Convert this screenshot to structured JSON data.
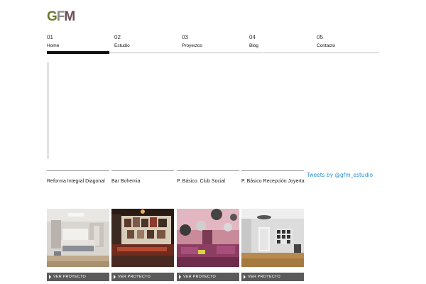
{
  "logo": {
    "g": "G",
    "f": "F",
    "m": "M"
  },
  "nav": [
    {
      "num": "01",
      "label": "Home"
    },
    {
      "num": "02",
      "label": "Estudio"
    },
    {
      "num": "03",
      "label": "Proyectos"
    },
    {
      "num": "04",
      "label": "Blog"
    },
    {
      "num": "05",
      "label": "Contacto"
    }
  ],
  "projects": [
    {
      "title": "Reforma Integral Diagonal",
      "cta": "VER PROYECTO"
    },
    {
      "title": "Bar Bohemia",
      "cta": "VER PROYECTO"
    },
    {
      "title": "P. Básico. Club Social",
      "cta": "VER PROYECTO"
    },
    {
      "title": "P. Básico Recepción Joyerta",
      "cta": "VER PROYECTO"
    }
  ],
  "tweets": "Tweets by @gfm_estudio",
  "colors": {
    "accent_link": "#2e8fd0",
    "button_bg": "#5a5a5a",
    "nav_active": "#111111"
  }
}
